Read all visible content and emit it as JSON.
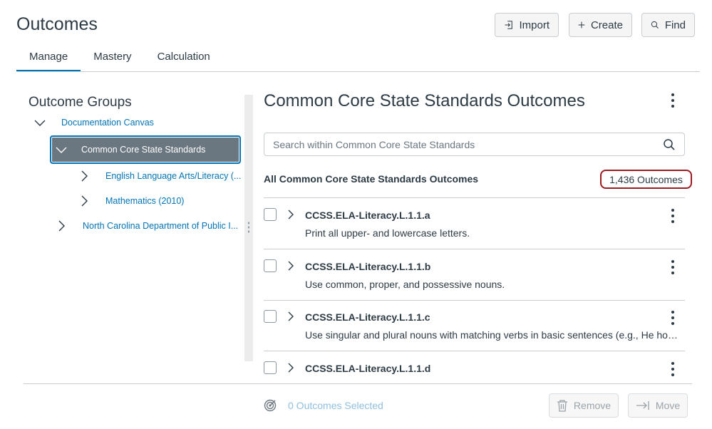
{
  "header": {
    "title": "Outcomes",
    "import_label": "Import",
    "create_label": "Create",
    "find_label": "Find"
  },
  "tabs": [
    {
      "label": "Manage",
      "active": true
    },
    {
      "label": "Mastery",
      "active": false
    },
    {
      "label": "Calculation",
      "active": false
    }
  ],
  "sidebar": {
    "title": "Outcome Groups",
    "items": [
      {
        "label": "Documentation Canvas",
        "expanded": true
      },
      {
        "label": "Common Core State Standards",
        "expanded": true,
        "selected": true
      },
      {
        "label": "English Language Arts/Literacy (...",
        "expanded": false
      },
      {
        "label": "Mathematics (2010)",
        "expanded": false
      },
      {
        "label": "North Carolina Department of Public I...",
        "expanded": false
      }
    ]
  },
  "main": {
    "title": "Common Core State Standards Outcomes",
    "search_placeholder": "Search within Common Core State Standards",
    "all_label": "All Common Core State Standards Outcomes",
    "count_label": "1,436 Outcomes",
    "outcomes": [
      {
        "code": "CCSS.ELA-Literacy.L.1.1.a",
        "description": "Print all upper- and lowercase letters."
      },
      {
        "code": "CCSS.ELA-Literacy.L.1.1.b",
        "description": "Use common, proper, and possessive nouns."
      },
      {
        "code": "CCSS.ELA-Literacy.L.1.1.c",
        "description": "Use singular and plural nouns with matching verbs in basic sentences (e.g., He hops..."
      },
      {
        "code": "CCSS.ELA-Literacy.L.1.1.d",
        "description": ""
      }
    ]
  },
  "footer": {
    "selected_label": "0 Outcomes Selected",
    "remove_label": "Remove",
    "move_label": "Move"
  },
  "colors": {
    "accent": "#0374b5",
    "text": "#2d3b45",
    "highlight_border": "#9b1c21",
    "selected_bg": "#6b7780"
  }
}
